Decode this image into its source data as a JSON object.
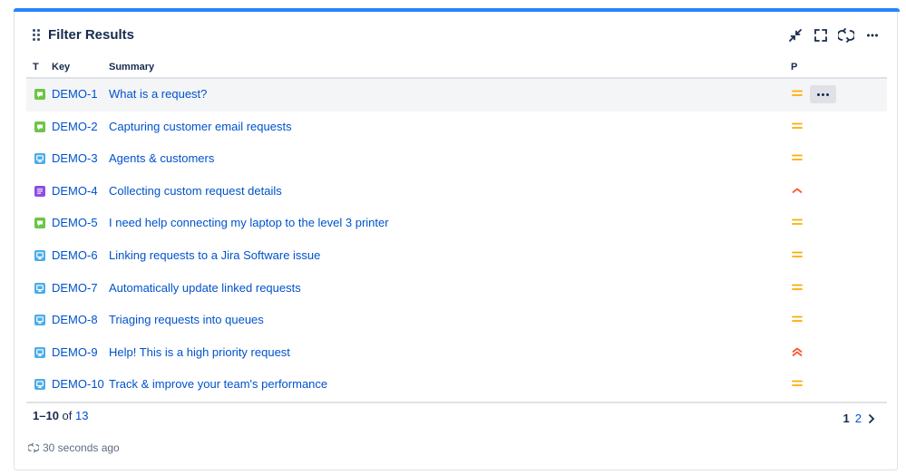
{
  "gadget": {
    "title": "Filter Results",
    "accent": "#2684ff",
    "actions": [
      {
        "name": "minimize-icon"
      },
      {
        "name": "fullscreen-icon"
      },
      {
        "name": "refresh-icon"
      },
      {
        "name": "more-icon"
      }
    ]
  },
  "columns": {
    "type": "T",
    "key": "Key",
    "summary": "Summary",
    "priority": "P"
  },
  "rows": [
    {
      "key": "DEMO-1",
      "summary": "What is a request?",
      "type": "chat",
      "priority": "medium"
    },
    {
      "key": "DEMO-2",
      "summary": "Capturing customer email requests",
      "type": "chat",
      "priority": "medium"
    },
    {
      "key": "DEMO-3",
      "summary": "Agents & customers",
      "type": "screen",
      "priority": "medium"
    },
    {
      "key": "DEMO-4",
      "summary": "Collecting custom request details",
      "type": "form",
      "priority": "high"
    },
    {
      "key": "DEMO-5",
      "summary": "I need help connecting my laptop to the level 3 printer",
      "type": "chat",
      "priority": "medium"
    },
    {
      "key": "DEMO-6",
      "summary": "Linking requests to a Jira Software issue",
      "type": "screen",
      "priority": "medium"
    },
    {
      "key": "DEMO-7",
      "summary": "Automatically update linked requests",
      "type": "screen",
      "priority": "medium"
    },
    {
      "key": "DEMO-8",
      "summary": "Triaging requests into queues",
      "type": "screen",
      "priority": "medium"
    },
    {
      "key": "DEMO-9",
      "summary": "Help! This is a high priority request",
      "type": "screen",
      "priority": "highest"
    },
    {
      "key": "DEMO-10",
      "summary": "Track & improve your team's performance",
      "type": "screen",
      "priority": "medium"
    }
  ],
  "colors": {
    "chat": "#6cc644",
    "screen": "#4bade8",
    "form": "#904ee2",
    "medium": "#ffab00",
    "high": "#ff5630",
    "highest": "#ff5630",
    "link": "#0052cc"
  },
  "footer": {
    "range": "1–10",
    "of": "of",
    "total": "13",
    "pages": [
      "1",
      "2"
    ],
    "current_page": "1",
    "refreshed": "30 seconds ago"
  }
}
